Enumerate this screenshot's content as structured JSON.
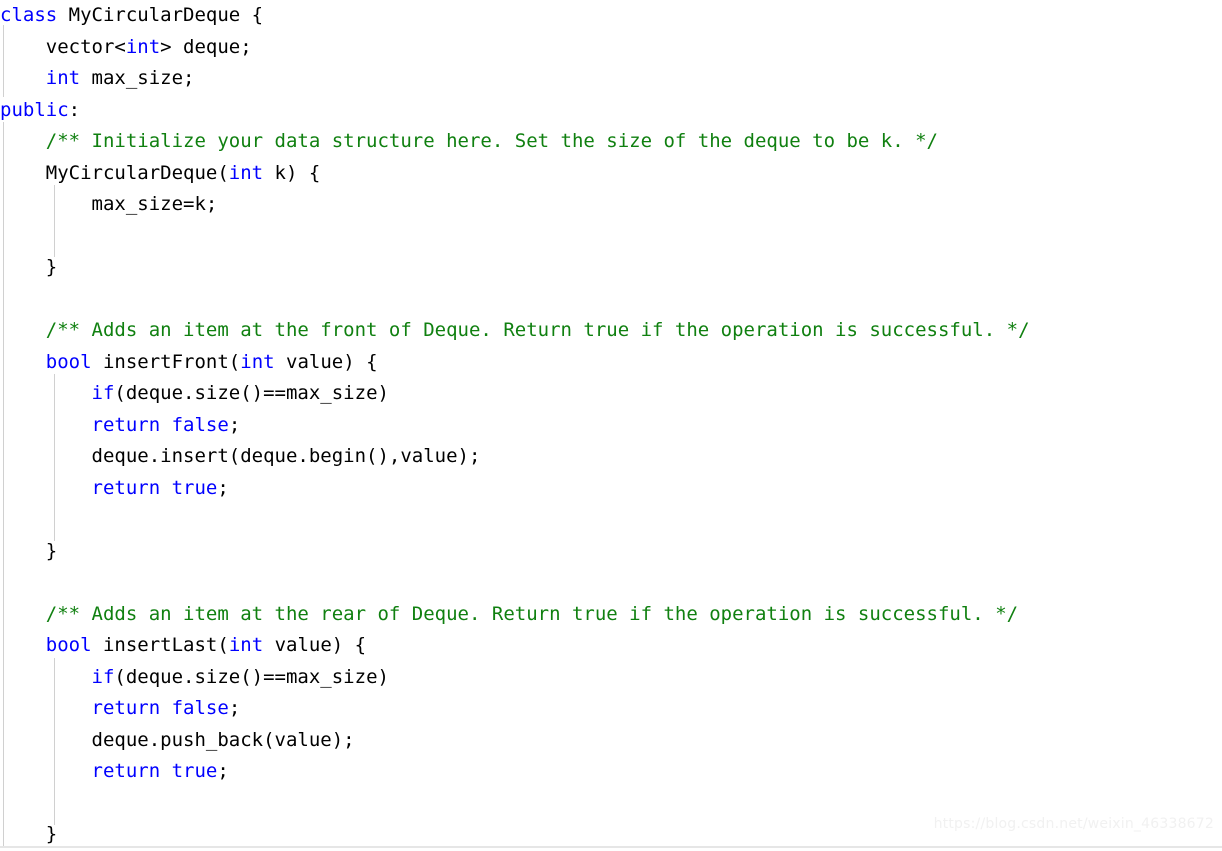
{
  "editor": {
    "language": "cpp",
    "colors": {
      "background": "#ffffff",
      "text": "#000000",
      "keyword": "#0000ff",
      "comment": "#108010",
      "indent_guide": "#d0d0d0",
      "watermark": "#f1f1f1"
    },
    "font_size_px": 19,
    "line_height_px": 31.5
  },
  "watermark": {
    "text": "https://blog.csdn.net/weixin_46338672"
  },
  "code": {
    "lines": [
      [
        {
          "t": "class",
          "c": "kw"
        },
        {
          "t": " MyCircularDeque {",
          "c": "pl"
        }
      ],
      [
        {
          "t": "    vector<",
          "c": "pl"
        },
        {
          "t": "int",
          "c": "kw"
        },
        {
          "t": "> deque;",
          "c": "pl"
        }
      ],
      [
        {
          "t": "    ",
          "c": "pl"
        },
        {
          "t": "int",
          "c": "kw"
        },
        {
          "t": " max_size;",
          "c": "pl"
        }
      ],
      [
        {
          "t": "public",
          "c": "kw"
        },
        {
          "t": ":",
          "c": "pl"
        }
      ],
      [
        {
          "t": "    /** Initialize your data structure here. Set the size of the deque to be k. */",
          "c": "cmt"
        }
      ],
      [
        {
          "t": "    MyCircularDeque(",
          "c": "pl"
        },
        {
          "t": "int",
          "c": "kw"
        },
        {
          "t": " k) {",
          "c": "pl"
        }
      ],
      [
        {
          "t": "        max_size=k;",
          "c": "pl"
        }
      ],
      [
        {
          "t": "",
          "c": "pl"
        }
      ],
      [
        {
          "t": "    }",
          "c": "pl"
        }
      ],
      [
        {
          "t": "",
          "c": "pl"
        }
      ],
      [
        {
          "t": "    /** Adds an item at the front of Deque. Return true if the operation is successful. */",
          "c": "cmt"
        }
      ],
      [
        {
          "t": "    ",
          "c": "pl"
        },
        {
          "t": "bool",
          "c": "kw"
        },
        {
          "t": " insertFront(",
          "c": "pl"
        },
        {
          "t": "int",
          "c": "kw"
        },
        {
          "t": " value) {",
          "c": "pl"
        }
      ],
      [
        {
          "t": "        ",
          "c": "pl"
        },
        {
          "t": "if",
          "c": "kw"
        },
        {
          "t": "(deque.size()==max_size)",
          "c": "pl"
        }
      ],
      [
        {
          "t": "        ",
          "c": "pl"
        },
        {
          "t": "return",
          "c": "kw"
        },
        {
          "t": " ",
          "c": "pl"
        },
        {
          "t": "false",
          "c": "kw"
        },
        {
          "t": ";",
          "c": "pl"
        }
      ],
      [
        {
          "t": "        deque.insert(deque.begin(),value);",
          "c": "pl"
        }
      ],
      [
        {
          "t": "        ",
          "c": "pl"
        },
        {
          "t": "return",
          "c": "kw"
        },
        {
          "t": " ",
          "c": "pl"
        },
        {
          "t": "true",
          "c": "kw"
        },
        {
          "t": ";",
          "c": "pl"
        }
      ],
      [
        {
          "t": "",
          "c": "pl"
        }
      ],
      [
        {
          "t": "    }",
          "c": "pl"
        }
      ],
      [
        {
          "t": "",
          "c": "pl"
        }
      ],
      [
        {
          "t": "    /** Adds an item at the rear of Deque. Return true if the operation is successful. */",
          "c": "cmt"
        }
      ],
      [
        {
          "t": "    ",
          "c": "pl"
        },
        {
          "t": "bool",
          "c": "kw"
        },
        {
          "t": " insertLast(",
          "c": "pl"
        },
        {
          "t": "int",
          "c": "kw"
        },
        {
          "t": " value) {",
          "c": "pl"
        }
      ],
      [
        {
          "t": "        ",
          "c": "pl"
        },
        {
          "t": "if",
          "c": "kw"
        },
        {
          "t": "(deque.size()==max_size)",
          "c": "pl"
        }
      ],
      [
        {
          "t": "        ",
          "c": "pl"
        },
        {
          "t": "return",
          "c": "kw"
        },
        {
          "t": " ",
          "c": "pl"
        },
        {
          "t": "false",
          "c": "kw"
        },
        {
          "t": ";",
          "c": "pl"
        }
      ],
      [
        {
          "t": "        deque.push_back(value);",
          "c": "pl"
        }
      ],
      [
        {
          "t": "        ",
          "c": "pl"
        },
        {
          "t": "return",
          "c": "kw"
        },
        {
          "t": " ",
          "c": "pl"
        },
        {
          "t": "true",
          "c": "kw"
        },
        {
          "t": ";",
          "c": "pl"
        }
      ],
      [
        {
          "t": "",
          "c": "pl"
        }
      ],
      [
        {
          "t": "    }",
          "c": "pl"
        }
      ]
    ]
  }
}
